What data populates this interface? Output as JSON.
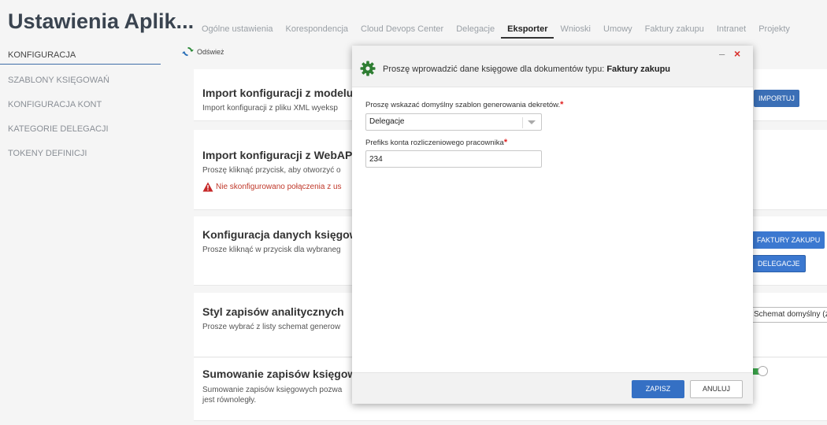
{
  "app": {
    "title": "Ustawienia Aplik..."
  },
  "tabs": [
    {
      "label": "Ogólne ustawienia"
    },
    {
      "label": "Korespondencja"
    },
    {
      "label": "Cloud Devops Center"
    },
    {
      "label": "Delegacje"
    },
    {
      "label": "Eksporter",
      "active": true
    },
    {
      "label": "Wnioski"
    },
    {
      "label": "Umowy"
    },
    {
      "label": "Faktury zakupu"
    },
    {
      "label": "Intranet"
    },
    {
      "label": "Projekty"
    }
  ],
  "sidebar": {
    "items": [
      {
        "label": "KONFIGURACJA",
        "active": true
      },
      {
        "label": "SZABLONY KSIĘGOWAŃ"
      },
      {
        "label": "KONFIGURACJA KONT"
      },
      {
        "label": "KATEGORIE DELEGACJI"
      },
      {
        "label": "TOKENY DEFINICJI"
      }
    ]
  },
  "toolbar": {
    "refresh_label": "Odśwież"
  },
  "cards": {
    "import_model": {
      "title": "Import konfiguracji z modelu k",
      "desc": "Import konfiguracji z pliku XML wyeksp",
      "button": "IMPORTUJ"
    },
    "import_webapi": {
      "title": "Import konfiguracji z WebAPI",
      "desc": "Proszę kliknąć przycisk, aby otworzyć o",
      "warning": "Nie skonfigurowano połączenia z us"
    },
    "accounting_config": {
      "title": "Konfiguracja danych księgowy",
      "desc": "Prosze kliknąć w przycisk dla wybraneg",
      "button_invoices": "FAKTURY ZAKUPU",
      "button_delegations": "DELEGACJE"
    },
    "analytic_style": {
      "title": "Styl zapisów analitycznych",
      "desc": "Prosze wybrać z listy schemat generow",
      "select_value": "Schemat domyślny (z"
    },
    "summing": {
      "title": "Sumowanie zapisów księgowy",
      "desc_line1": "Sumowanie zapisów księgowych pozwa",
      "desc_line2": "jest równoległy."
    }
  },
  "modal": {
    "title_prefix": "Proszę wprowadzić dane księgowe dla dokumentów typu: ",
    "title_doc_type": "Faktury zakupu",
    "minimize": "–",
    "close": "×",
    "template_label": "Proszę wskazać domyślny szablon generowania dekretów.",
    "template_value": "Delegacje",
    "prefix_label": "Prefiks konta rozliczeniowego pracownika",
    "prefix_value": "234",
    "required_mark": "*",
    "save_label": "ZAPISZ",
    "cancel_label": "ANULUJ"
  },
  "colors": {
    "accent": "#3570c4",
    "required": "#e02020",
    "warning": "#c0392b",
    "gear": "#2e7d32"
  },
  "icons": {
    "refresh": "refresh-icon",
    "gear": "gear-icon",
    "warning": "warning-icon"
  }
}
